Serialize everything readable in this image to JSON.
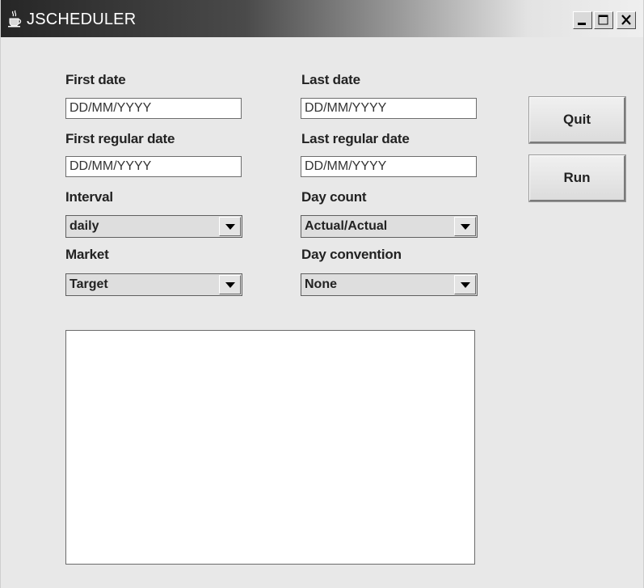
{
  "window": {
    "title": "JSCHEDULER"
  },
  "titlebar_buttons": {
    "minimize_icon": "minimize-icon",
    "maximize_icon": "maximize-icon",
    "close_icon": "close-icon"
  },
  "form": {
    "first_date": {
      "label": "First date",
      "value": "DD/MM/YYYY"
    },
    "last_date": {
      "label": "Last date",
      "value": "DD/MM/YYYY"
    },
    "first_regular_date": {
      "label": "First regular date",
      "value": "DD/MM/YYYY"
    },
    "last_regular_date": {
      "label": "Last regular date",
      "value": "DD/MM/YYYY"
    },
    "interval": {
      "label": "Interval",
      "selected": "daily"
    },
    "day_count": {
      "label": "Day count",
      "selected": "Actual/Actual"
    },
    "market": {
      "label": "Market",
      "selected": "Target"
    },
    "day_convention": {
      "label": "Day convention",
      "selected": "None"
    }
  },
  "actions": {
    "quit_label": "Quit",
    "run_label": "Run"
  },
  "output": {
    "value": ""
  },
  "colors": {
    "window_bg": "#e8e8e8",
    "titlebar_start": "#262626",
    "titlebar_end": "#efefef",
    "field_bg": "#ffffff"
  }
}
